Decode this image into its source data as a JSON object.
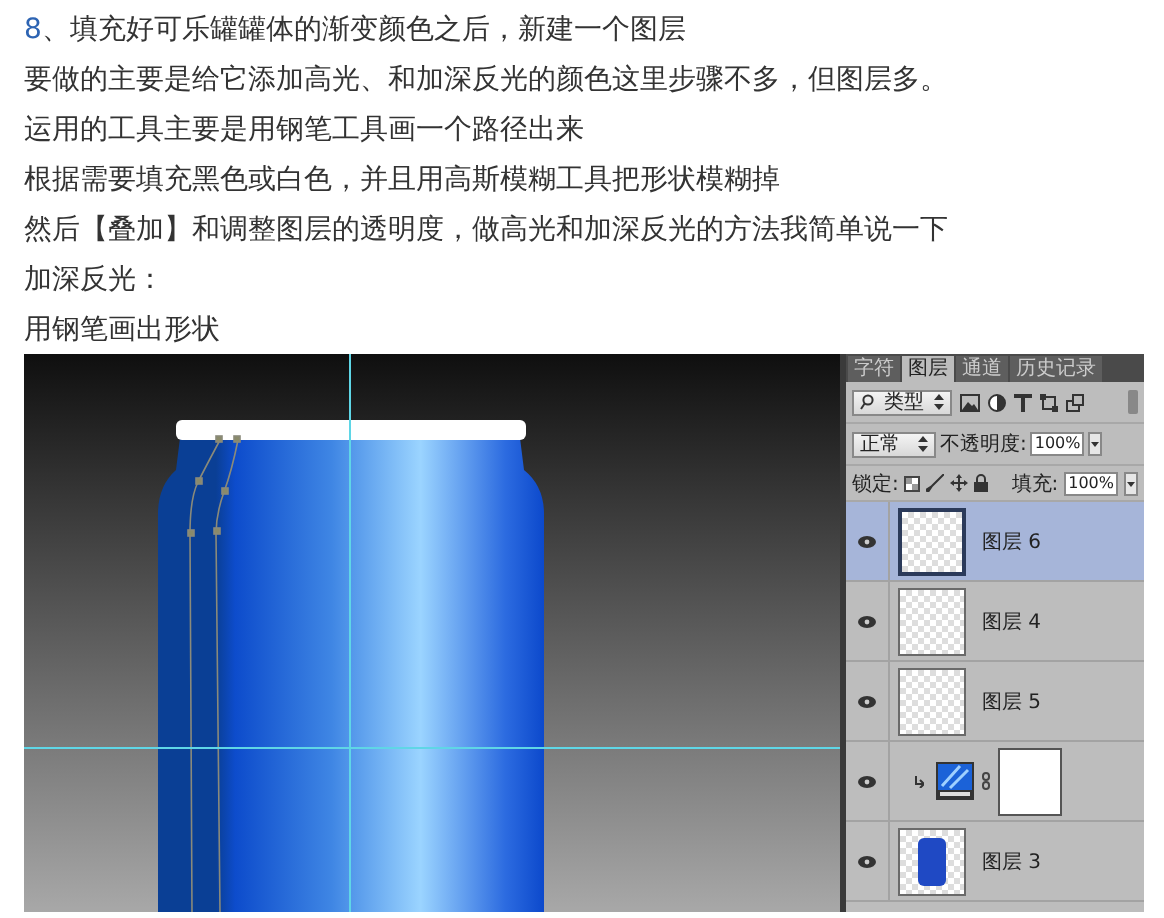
{
  "article": {
    "step_number": "8",
    "heading": "、填充好可乐罐罐体的渐变颜色之后，新建一个图层",
    "paragraphs": [
      "要做的主要是给它添加高光、和加深反光的颜色这里步骤不多，但图层多。",
      "运用的工具主要是用钢笔工具画一个路径出来",
      "根据需要填充黑色或白色，并且用高斯模糊工具把形状模糊掉",
      "然后【叠加】和调整图层的透明度，做高光和加深反光的方法我简单说一下",
      "加深反光：",
      "用钢笔画出形状"
    ]
  },
  "layers_panel": {
    "tabs": [
      {
        "label": "字符",
        "selected": false
      },
      {
        "label": "图层",
        "selected": true
      },
      {
        "label": "通道",
        "selected": false
      },
      {
        "label": "历史记录",
        "selected": false
      }
    ],
    "filter": "类型",
    "blend_mode": "正常",
    "opacity_label": "不透明度:",
    "opacity": "100%",
    "lock_label": "锁定:",
    "fill_label": "填充:",
    "fill": "100%",
    "layers": [
      {
        "kind": "pixel",
        "name": "图层 6",
        "visible": true,
        "selected": true
      },
      {
        "kind": "pixel",
        "name": "图层 4",
        "visible": true,
        "selected": false
      },
      {
        "kind": "pixel",
        "name": "图层 5",
        "visible": true,
        "selected": false
      },
      {
        "kind": "adjustment",
        "visible": true,
        "selected": false
      },
      {
        "kind": "shape",
        "name": "图层 3",
        "visible": true,
        "selected": false
      }
    ]
  }
}
